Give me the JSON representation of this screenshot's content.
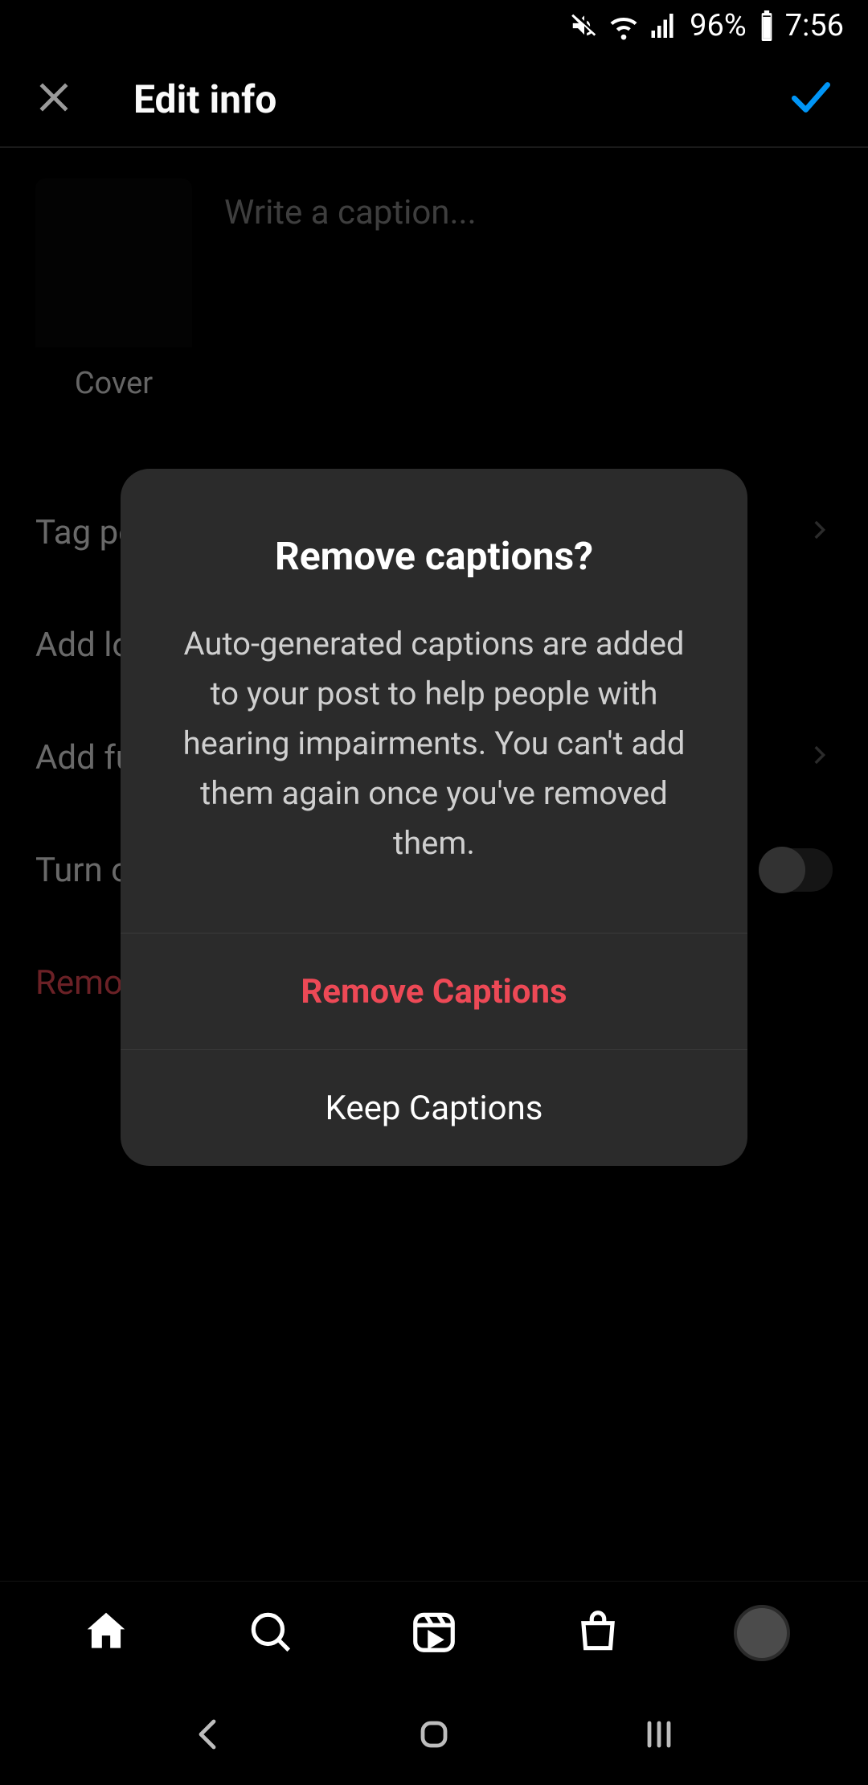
{
  "status_bar": {
    "battery_pct": "96%",
    "time": "7:56"
  },
  "header": {
    "title": "Edit info"
  },
  "editor": {
    "caption_placeholder": "Write a caption...",
    "cover_label": "Cover",
    "rows": {
      "tag_people": "Tag people",
      "add_location": "Add location",
      "add_fundraiser": "Add fundraiser",
      "turn_off_commenting": "Turn off commenting"
    },
    "remove_captions_link": "Remove auto-generated captions"
  },
  "dialog": {
    "title": "Remove captions?",
    "body": "Auto-generated captions are added to your post to help people with hearing impairments. You can't add them again once you've removed them.",
    "remove_label": "Remove Captions",
    "keep_label": "Keep Captions"
  },
  "colors": {
    "destructive": "#ed4956",
    "accent_confirm": "#0095f6"
  }
}
